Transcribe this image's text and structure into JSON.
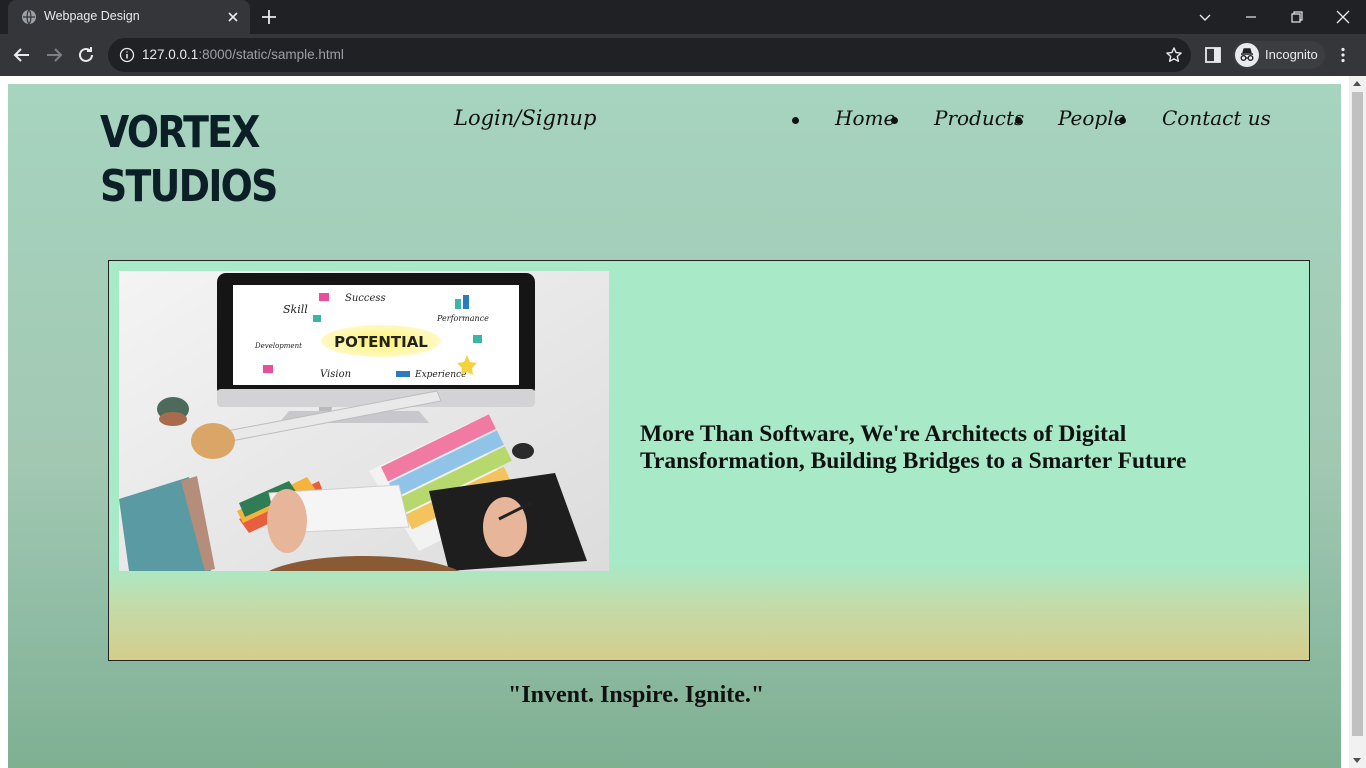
{
  "browser": {
    "tab_title": "Webpage Design",
    "url_host": "127.0.0.1",
    "url_rest": ":8000/static/sample.html",
    "profile_label": "Incognito"
  },
  "site": {
    "logo_line1": "VORTEX",
    "logo_line2": "STUDIOS",
    "login_label": "Login/Signup",
    "nav": [
      "Home",
      "Products",
      "People",
      "Contact us"
    ],
    "hero_text": "More Than Software, We're Architects of Digital Transformation, Building Bridges to a Smarter Future",
    "hero_image": {
      "screen_words": [
        "Skill",
        "Success",
        "Performance",
        "POTENTIAL",
        "Development",
        "Vision",
        "Experience"
      ]
    },
    "tagline": "\"Invent. Inspire. Ignite.\""
  },
  "colors": {
    "chrome_dark": "#202124",
    "chrome_tab": "#35363a",
    "page_bg": "#a6d4bf",
    "hero_bg": "#a8e9c7",
    "hero_bottom": "#d5cd8c",
    "logo": "#0c1f27"
  }
}
